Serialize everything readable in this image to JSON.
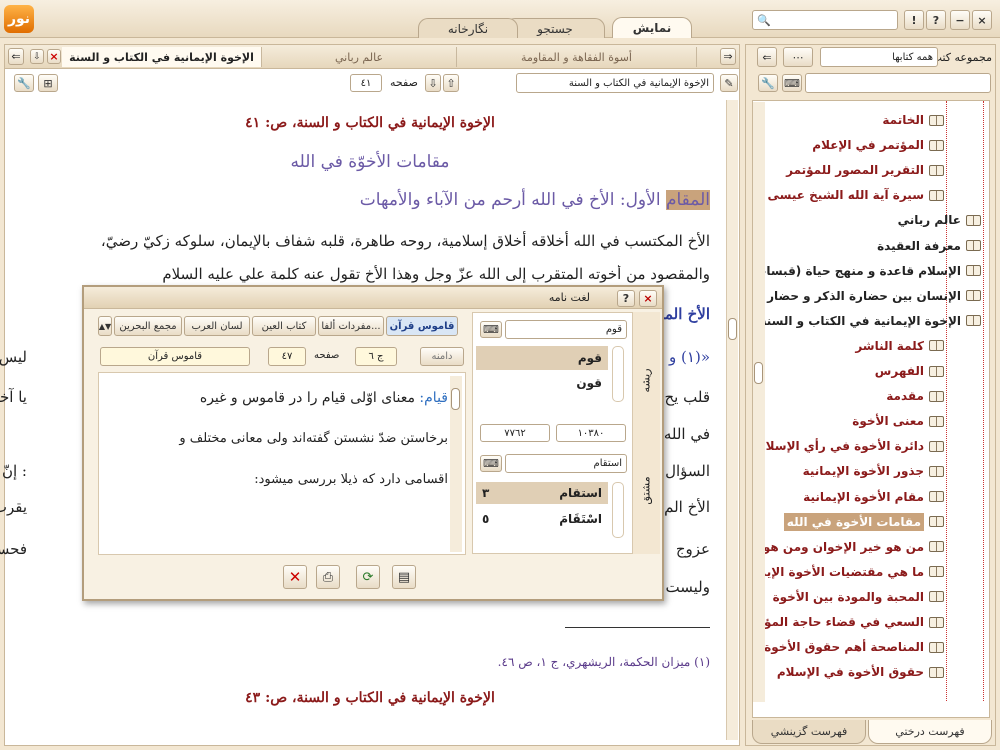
{
  "window": {
    "logo": "نور"
  },
  "window_buttons": [
    "?",
    "!",
    "−",
    "×",
    "□"
  ],
  "top_tabs": [
    {
      "label": "نمايش",
      "active": true
    },
    {
      "label": "جستجو",
      "active": false
    },
    {
      "label": "نگارخانه",
      "active": false
    }
  ],
  "doc_tabs": [
    {
      "label": "الإخوة الإيمانية في الكتاب و السنة",
      "active": true
    },
    {
      "label": "عالم رباني",
      "active": false
    },
    {
      "label": "أسوة الفقاهة و المقاومة",
      "active": false
    }
  ],
  "toolbar": {
    "book_field": "الإخوة الإيمانية في الكتاب و السنة",
    "page_label": "صفحه",
    "page_value": "٤١"
  },
  "sidebar": {
    "collections_label": "مجموعه كتب",
    "collections_value": "همه كتابها",
    "tree": [
      {
        "label": "الخاتمة",
        "level": 2,
        "color": "#8b1a1a"
      },
      {
        "label": "المؤتمر في الإعلام",
        "level": 2,
        "color": "#8b1a1a"
      },
      {
        "label": "التقرير المصور للمؤتمر",
        "level": 2,
        "color": "#8b1a1a"
      },
      {
        "label": "سيرة آية الله الشيخ عيسى أح",
        "level": 2,
        "color": "#8b1a1a"
      },
      {
        "label": "عالم رباني",
        "level": 1,
        "color": "#222"
      },
      {
        "label": "معرفة العقيدة",
        "level": 1,
        "color": "#222"
      },
      {
        "label": "الإسلام قاعدة و منهج حياة (قبسات",
        "level": 1,
        "color": "#222"
      },
      {
        "label": "الإنسان بين حضارة الذكر و حضار",
        "level": 1,
        "color": "#222"
      },
      {
        "label": "الإخوة الإيمانية في الكتاب و السنة",
        "level": 1,
        "color": "#222"
      },
      {
        "label": "كلمة الناشر",
        "level": 2,
        "color": "#8b1a1a"
      },
      {
        "label": "الفهرس",
        "level": 2,
        "color": "#8b1a1a"
      },
      {
        "label": "مقدمة",
        "level": 2,
        "color": "#8b1a1a"
      },
      {
        "label": "معنى الأخوة",
        "level": 2,
        "color": "#8b1a1a"
      },
      {
        "label": "دائرة الأخوة في رأي الإسلام",
        "level": 2,
        "color": "#8b1a1a"
      },
      {
        "label": "جذور الأخوة الإيمانية",
        "level": 2,
        "color": "#8b1a1a"
      },
      {
        "label": "مقام الأخوة الإيمانية",
        "level": 2,
        "color": "#8b1a1a"
      },
      {
        "label": "مقامات الأخوة في الله",
        "level": 2,
        "color": "#ffffff",
        "selected": true
      },
      {
        "label": "من هو خير الإخوان ومن هو شر",
        "level": 2,
        "color": "#8b1a1a"
      },
      {
        "label": "ما هي مقتضيات الأخوة الإيمانية",
        "level": 2,
        "color": "#8b1a1a"
      },
      {
        "label": "المحبة والمودة بين الأخوة",
        "level": 2,
        "color": "#8b1a1a"
      },
      {
        "label": "السعي في قضاء حاجة المؤمن",
        "level": 2,
        "color": "#8b1a1a"
      },
      {
        "label": "المناصحة أهم حقوق الأخوة الإ",
        "level": 2,
        "color": "#8b1a1a"
      },
      {
        "label": "حقوق الأخوة في الإسلام",
        "level": 2,
        "color": "#8b1a1a"
      }
    ],
    "bottom_tabs": [
      {
        "label": "فهرست درختي",
        "active": true
      },
      {
        "label": "فهرست گزينشي",
        "active": false
      }
    ]
  },
  "content": {
    "header": "الإخوة الإيمانية في الكتاب و السنة، ص: ٤١",
    "section_title": "مقامات الأخوّة في الله",
    "highlight_word": "المقام",
    "line1_rest": " الأول: الأخ في الله أرحم من الآباء والأمهات",
    "line2": "الأخ المكتسب في الله أخلاقه أخلاق إسلامية، روحه طاهرة، قلبه شفاف بالإيمان، سلوكه زكيّ رضيّ،",
    "line3": "والمقصود من أخوته المتقرب إلى الله عزّ وجل وهذا الأخ تقول عنه كلمة علي عليه السلام",
    "line4": "الأخ المؤمن",
    "line5a": "«(١) و",
    "line5b": "ليس من",
    "line6a": "قلب يح",
    "line6b": "يا آخيته",
    "line7a": "في الله",
    "line8a": "السؤال",
    "line8b": ": إنّ هذا",
    "line9a": "الأخ الم",
    "line9b": "يقرب لله",
    "line10a": "عزوج",
    "line10b": "فحسب،",
    "line11a": "وليست",
    "footnote": "(١) ميزان الحكمة، الريشهري، ج ١، ص ٤٦.",
    "next_header": "الإخوة الإيمانية في الكتاب و السنة، ص: ٤٣"
  },
  "dialog": {
    "title": "لغت نامه",
    "search1": "قوم",
    "search2": "استقام",
    "vtab1": "ريشه",
    "vtab2": "مشتق",
    "root_results": [
      {
        "word": "قوم",
        "selected": true
      },
      {
        "word": "قون",
        "selected": false
      }
    ],
    "derived_results": [
      {
        "word": "استقام",
        "count": "٣",
        "selected": true
      },
      {
        "word": "اسْتَقَامَ",
        "count": "٥",
        "selected": false
      }
    ],
    "range_a": "١٠٣٨٠",
    "range_b": "٧٧٦٢",
    "dict_tabs": [
      "قاموس قرآن",
      "مفردات ألفا...",
      "كتاب العين",
      "لسان العرب",
      "مجمع البحرين"
    ],
    "scope_label": "دامنه",
    "vol_value": "ج ٦",
    "page_label": "صفحه",
    "page_value": "٤٧",
    "dict_name": "قاموس قرآن",
    "definition_word": "قيام:",
    "definition_line1": "معناى اوّلى قيام را در قاموس و غيره",
    "definition_line2": "برخاستن ضدّ نشستن گفته‌اند ولى معانى مختلف و",
    "definition_line3": "اقسامى دارد كه ذيلا بررسى ميشود:"
  }
}
